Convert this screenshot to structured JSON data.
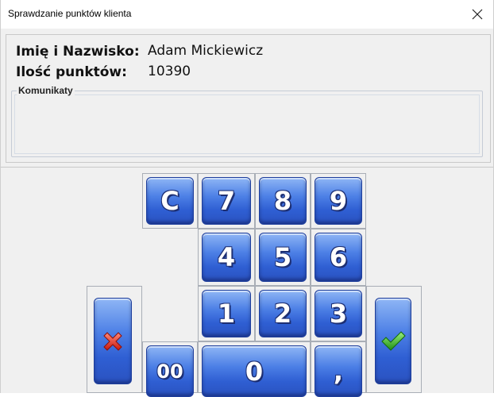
{
  "window": {
    "title": "Sprawdzanie punktów klienta",
    "close_glyph": "✕"
  },
  "client": {
    "name_label": "Imię i Nazwisko:",
    "name_value": "Adam Mickiewicz",
    "points_label": "Ilość punktów:",
    "points_value": "10390"
  },
  "messages": {
    "legend": "Komunikaty",
    "text": ""
  },
  "keypad": {
    "clear": "C",
    "k7": "7",
    "k8": "8",
    "k9": "9",
    "k4": "4",
    "k5": "5",
    "k6": "6",
    "k1": "1",
    "k2": "2",
    "k3": "3",
    "k00": "00",
    "k0": "0",
    "comma": ",",
    "cancel_icon": "x-icon",
    "confirm_icon": "check-icon"
  },
  "colors": {
    "key_blue": "#3a6bd9",
    "cancel_red": "#e23a2a",
    "confirm_green": "#3bb82d"
  }
}
